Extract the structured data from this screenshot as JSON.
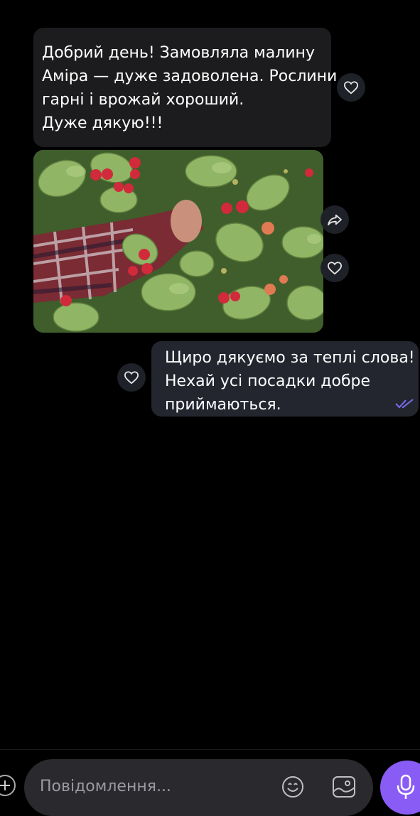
{
  "conversation": {
    "incoming_message": {
      "lines": [
        "Добрий день! Замовляла малину",
        "Аміра — дуже задоволена. Рослини",
        "гарні і врожай хороший.",
        "Дуже дякую!!!"
      ]
    },
    "outgoing_message": {
      "lines": [
        "Щиро дякуємо за теплі слова!",
        "Нехай усі посадки добре",
        "приймаються."
      ],
      "status": "read"
    }
  },
  "composer": {
    "placeholder": "Повідомлення..."
  },
  "icons": {
    "like": "heart-icon",
    "forward": "forward-icon",
    "read_status": "double-check-icon",
    "attach": "plus-icon",
    "emoji": "smiley-icon",
    "gallery": "image-icon",
    "voice": "microphone-icon"
  },
  "colors": {
    "background": "#000000",
    "incoming_bubble": "#1c1c1e",
    "outgoing_bubble": "#23262f",
    "accent": "#8a5cf6",
    "read_ticks": "#7c6cf0"
  }
}
